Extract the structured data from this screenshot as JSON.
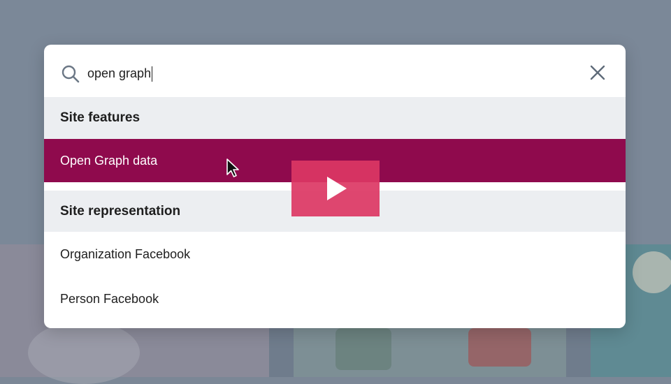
{
  "search": {
    "value": "open graph",
    "icon": "search-icon"
  },
  "close": {
    "icon": "close-icon"
  },
  "sections": [
    {
      "title": "Site features",
      "items": [
        {
          "label": "Open Graph data",
          "active": true
        }
      ]
    },
    {
      "title": "Site representation",
      "items": [
        {
          "label": "Organization Facebook",
          "active": false
        },
        {
          "label": "Person Facebook",
          "active": false
        }
      ]
    }
  ],
  "overlay": {
    "play_icon": "play-icon",
    "cursor_icon": "mouse-pointer-icon"
  },
  "colors": {
    "accent": "#8f0a4d",
    "play_button": "#dc3764",
    "section_bg": "#eceef1",
    "backdrop": "#7b8898"
  }
}
